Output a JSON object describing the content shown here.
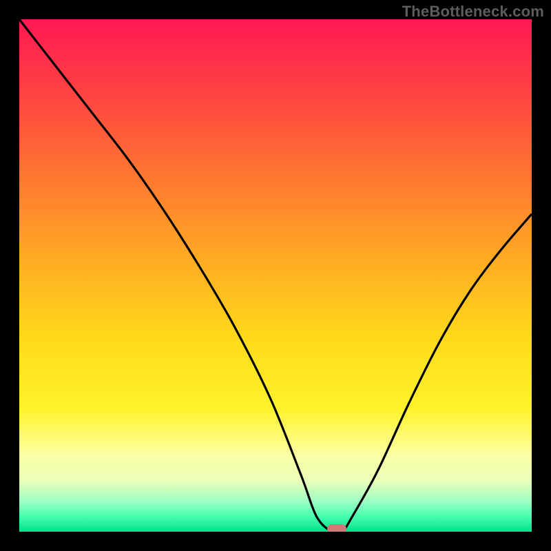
{
  "watermark": "TheBottleneck.com",
  "chart_data": {
    "type": "line",
    "title": "",
    "xlabel": "",
    "ylabel": "",
    "xlim": [
      0,
      100
    ],
    "ylim": [
      0,
      100
    ],
    "x": [
      0,
      7,
      14,
      21,
      28,
      35,
      42,
      49,
      55,
      58,
      61,
      63,
      65,
      70,
      76,
      82,
      88,
      94,
      100
    ],
    "values": [
      100,
      91,
      82,
      73,
      63,
      52,
      40,
      26,
      11,
      3,
      0,
      0,
      3,
      12,
      25,
      37,
      47,
      55,
      62
    ],
    "marker_x": 62,
    "marker_y": 0,
    "background_gradient_top": "#ff1853",
    "background_gradient_bottom": "#00e08a",
    "curve_color": "#000000",
    "marker_color": "#cc7a78"
  }
}
